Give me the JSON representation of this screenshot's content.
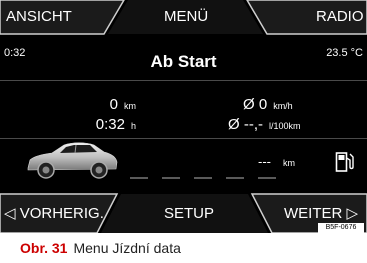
{
  "top_tabs": {
    "left": "ANSICHT",
    "center": "MENÜ",
    "right": "RADIO"
  },
  "status": {
    "time": "0:32",
    "temperature": "23.5 °C"
  },
  "title": "Ab Start",
  "stats": {
    "distance_value": "0",
    "distance_unit": "km",
    "duration_value": "0:32",
    "duration_unit": "h",
    "avg_speed_value": "Ø 0",
    "avg_speed_unit": "km/h",
    "avg_consumption_value": "Ø --,-",
    "avg_consumption_unit": "l/100km"
  },
  "range": {
    "value": "---",
    "unit": "km"
  },
  "bottom_tabs": {
    "left": "◁ VORHERIG.",
    "center": "SETUP",
    "right": "WEITER ▷"
  },
  "badge": "B5F-0676",
  "caption": {
    "number": "Obr. 31",
    "text": "Menu Jízdní data"
  },
  "icons": {
    "car": "car-side-icon",
    "fuel": "fuel-pump-icon"
  },
  "colors": {
    "screen_bg": "#000000",
    "tab_bg": "#1a1a1a",
    "caption_number": "#cc0000"
  }
}
